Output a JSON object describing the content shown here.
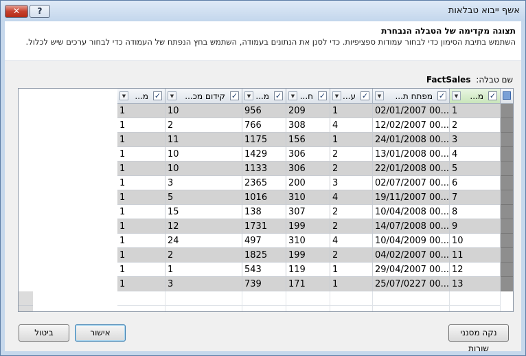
{
  "window": {
    "title": "אשף ייבוא טבלאות",
    "close_glyph": "✕",
    "help_glyph": "?"
  },
  "header": {
    "title": "תצוגה מקדימה של הטבלה הנבחרת",
    "description": "השתמש בתיבת הסימון כדי לבחור עמודות ספציפיות. כדי לסנן את הנתונים בעמודה, השתמש בחץ הנפתח של העמודה כדי לבחור ערכים שיש לכלול."
  },
  "table_name": {
    "label": "שם טבלה:",
    "value": "FactSales"
  },
  "grid": {
    "columns": [
      {
        "label": "מ...",
        "checked": true
      },
      {
        "label": "מפתח ת...",
        "checked": true
      },
      {
        "label": "ע...",
        "checked": true
      },
      {
        "label": "ח...",
        "checked": true
      },
      {
        "label": "מ...",
        "checked": true
      },
      {
        "label": "קידום מכ...",
        "checked": true
      },
      {
        "label": "מ...",
        "checked": true
      }
    ],
    "rows": [
      [
        "1",
        "02/01/2007 00...",
        "1",
        "209",
        "956",
        "10",
        "1"
      ],
      [
        "2",
        "12/02/2007 00...",
        "4",
        "308",
        "766",
        "2",
        "1"
      ],
      [
        "3",
        "24/01/2008 00...",
        "1",
        "156",
        "1175",
        "11",
        "1"
      ],
      [
        "4",
        "13/01/2008 00...",
        "2",
        "306",
        "1429",
        "10",
        "1"
      ],
      [
        "5",
        "22/01/2008 00...",
        "2",
        "306",
        "1133",
        "10",
        "1"
      ],
      [
        "6",
        "02/07/2007 00...",
        "3",
        "200",
        "2365",
        "3",
        "1"
      ],
      [
        "7",
        "19/11/2007 00...",
        "4",
        "310",
        "1016",
        "5",
        "1"
      ],
      [
        "8",
        "10/04/2008 00...",
        "2",
        "307",
        "138",
        "15",
        "1"
      ],
      [
        "9",
        "14/07/2008 00...",
        "2",
        "199",
        "1731",
        "12",
        "1"
      ],
      [
        "10",
        "10/04/2009 00...",
        "4",
        "310",
        "497",
        "24",
        "1"
      ],
      [
        "11",
        "04/02/2007 00...",
        "2",
        "199",
        "1825",
        "2",
        "1"
      ],
      [
        "12",
        "29/04/2007 00...",
        "1",
        "119",
        "543",
        "1",
        "1"
      ],
      [
        "13",
        "25/07/0227 00...",
        "1",
        "171",
        "739",
        "3",
        "1"
      ]
    ]
  },
  "buttons": {
    "clear_row_filters": "נקה מסנני שורות",
    "ok": "אישור",
    "cancel": "ביטול"
  }
}
